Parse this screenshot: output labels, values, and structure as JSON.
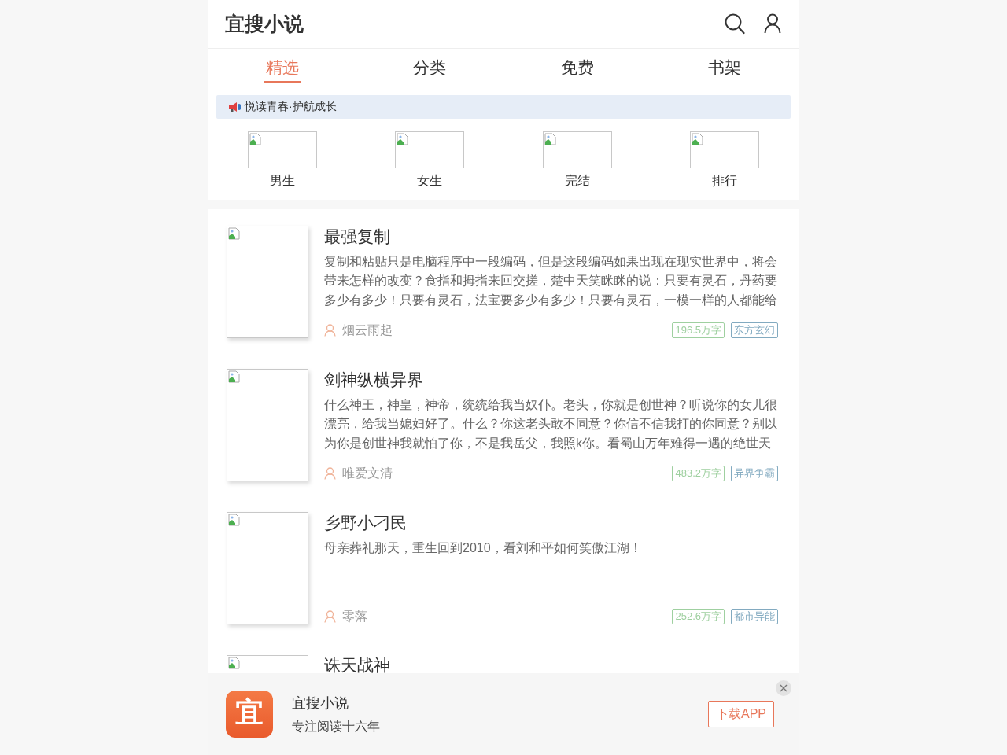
{
  "header": {
    "title": "宜搜小说"
  },
  "tabs": [
    {
      "label": "精选",
      "selected": true
    },
    {
      "label": "分类",
      "selected": false
    },
    {
      "label": "免费",
      "selected": false
    },
    {
      "label": "书架",
      "selected": false
    }
  ],
  "notice": {
    "text": "悦读青春·护航成长"
  },
  "categories": [
    {
      "label": "男生"
    },
    {
      "label": "女生"
    },
    {
      "label": "完结"
    },
    {
      "label": "排行"
    }
  ],
  "books": [
    {
      "title": "最强复制",
      "description": "复制和粘贴只是电脑程序中一段编码，但是这段编码如果出现在现实世界中，将会带来怎样的改变？食指和拇指来回交搓，楚中天笑眯眯的说：只要有灵石，丹药要多少有多少！只要有灵石，法宝要多少有多少！只要有灵石，一模一样的人都能给",
      "author": "烟云雨起",
      "word_count": "196.5万字",
      "genre": "东方玄幻"
    },
    {
      "title": "剑神纵横异界",
      "description": "什么神王，神皇，神帝，统统给我当奴仆。老头，你就是创世神？听说你的女儿很漂亮，给我当媳妇好了。什么？你这老头敢不同意？你信不信我打的你同意？别以为你是创世神我就怕了你，不是我岳父，我照k你。看蜀山万年难得一遇的绝世天",
      "author": "唯爱文清",
      "word_count": "483.2万字",
      "genre": "异界争霸"
    },
    {
      "title": "乡野小刁民",
      "description": "母亲葬礼那天，重生回到2010，看刘和平如何笑傲江湖！",
      "author": "零落",
      "word_count": "252.6万字",
      "genre": "都市异能"
    },
    {
      "title": "诛天战神"
    }
  ],
  "app_banner": {
    "logo_text": "宜",
    "name": "宜搜小说",
    "tagline": "专注阅读十六年",
    "button": "下载APP"
  }
}
